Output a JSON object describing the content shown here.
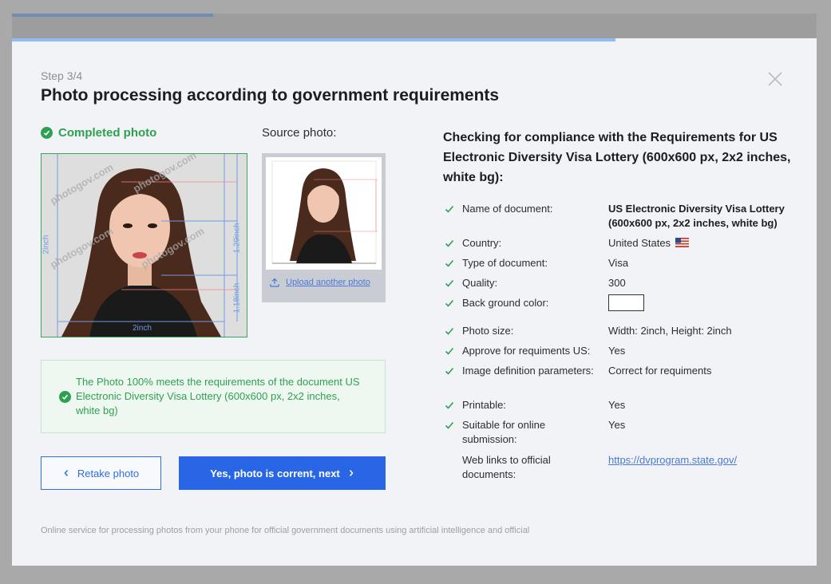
{
  "step": {
    "label": "Step 3/4"
  },
  "title": "Photo processing according to government requirements",
  "completed": {
    "label": "Completed photo",
    "watermark": "photogov.com",
    "dims": {
      "width": "2inch",
      "height": "2inch",
      "head": "1.29inch",
      "eyes": "1.18inch"
    }
  },
  "source": {
    "label": "Source photo:",
    "upload_label": "Upload another photo"
  },
  "success": {
    "text": "The Photo 100% meets the requirements of the document US Electronic Diversity Visa Lottery (600x600 px, 2x2 inches, white bg)"
  },
  "buttons": {
    "retake_label": "Retake photo",
    "next_label": "Yes, photo is corrent, next"
  },
  "footer": "Online service for processing photos from your phone for official government documents using artificial intelligence and official",
  "requirements": {
    "title": "Checking for compliance with the Requirements for US Electronic Diversity Visa Lottery (600x600 px, 2x2 inches, white bg):",
    "rows": [
      {
        "label": "Name of document:",
        "value": "US Electronic Diversity Visa Lottery (600x600 px, 2x2 inches, white bg)",
        "checked": true
      },
      {
        "label": "Country:",
        "value": "United States",
        "checked": true,
        "icon": "us-flag-icon"
      },
      {
        "label": "Type of document:",
        "value": "Visa",
        "checked": true
      },
      {
        "label": "Quality:",
        "value": "300",
        "checked": true
      },
      {
        "label": "Back ground color:",
        "value": "",
        "swatch": "#ffffff",
        "checked": true
      },
      {
        "label": "Photo size:",
        "value": "Width: 2inch, Height: 2inch",
        "checked": true
      },
      {
        "label": "Approve for requiments US:",
        "value": "Yes",
        "checked": true
      },
      {
        "label": "Image definition parameters:",
        "value": "Correct for requiments",
        "checked": true
      },
      {
        "label": "Printable:",
        "value": "Yes",
        "checked": true
      },
      {
        "label": "Suitable for online submission:",
        "value": "Yes",
        "checked": true
      },
      {
        "label": "Web links to official documents:",
        "value": "https://dvprogram.state.gov/",
        "checked": false,
        "link": true
      }
    ]
  },
  "colors": {
    "accent": "#2966e6",
    "success": "#2ea052",
    "progress": "#8fbdf0"
  }
}
